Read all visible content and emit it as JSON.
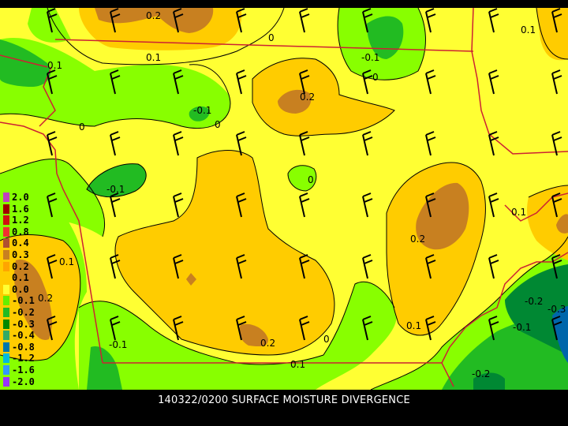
{
  "caption": "140322/0200 SURFACE MOISTURE DIVERGENCE",
  "legend": {
    "levels": [
      {
        "label": "2.0",
        "color": "#c040c0"
      },
      {
        "label": "1.6",
        "color": "#a00000"
      },
      {
        "label": "1.2",
        "color": "#d01010"
      },
      {
        "label": "0.8",
        "color": "#f03030"
      },
      {
        "label": "0.4",
        "color": "#b05030"
      },
      {
        "label": "0.3",
        "color": "#c88020"
      },
      {
        "label": "0.2",
        "color": "#ffa500"
      },
      {
        "label": "0.1",
        "color": "#ffcc00"
      },
      {
        "label": "0.0",
        "color": "#ffff33"
      },
      {
        "label": "-0.1",
        "color": "#66ee00"
      },
      {
        "label": "-0.2",
        "color": "#22bb22"
      },
      {
        "label": "-0.3",
        "color": "#008800"
      },
      {
        "label": "-0.4",
        "color": "#33aa66"
      },
      {
        "label": "-0.8",
        "color": "#0077aa"
      },
      {
        "label": "-1.2",
        "color": "#00bbdd"
      },
      {
        "label": "-1.6",
        "color": "#3399ff"
      },
      {
        "label": "-2.0",
        "color": "#9933ff"
      }
    ]
  },
  "contour_labels": {
    "top_02": "0.2",
    "top_01": "0.1",
    "top_0": "0",
    "tr_01": "0.1",
    "n_neg01": "-0.1",
    "n_0": "0",
    "c_02": "0.2",
    "nw_01": "0.1",
    "w_neg01": "-0.1",
    "w_0": "0",
    "wc_0": "0",
    "wc_neg01": "-0.1",
    "c_0": "0",
    "e_02": "0.2",
    "e_01": "0.1",
    "sw_01": "0.1",
    "sw_02": "0.2",
    "sw_neg01": "-0.1",
    "s_02": "0.2",
    "s_0": "0",
    "s_01": "0.1",
    "se_01": "0.1",
    "se_neg01": "-0.1",
    "se_neg02": "-0.2",
    "se_neg03": "-0.3",
    "se_neg02b": "-0.2"
  },
  "colors": {
    "zero_to_01": "#ffff33",
    "band_01_02": "#ffcc00",
    "band_02_03": "#c88020",
    "neg_01": "#88ff00",
    "neg_02": "#22bb22",
    "neg_03": "#008833",
    "neg_04": "#227744",
    "deep": "#0066aa",
    "border": "#cc2233",
    "barb": "#000000"
  }
}
